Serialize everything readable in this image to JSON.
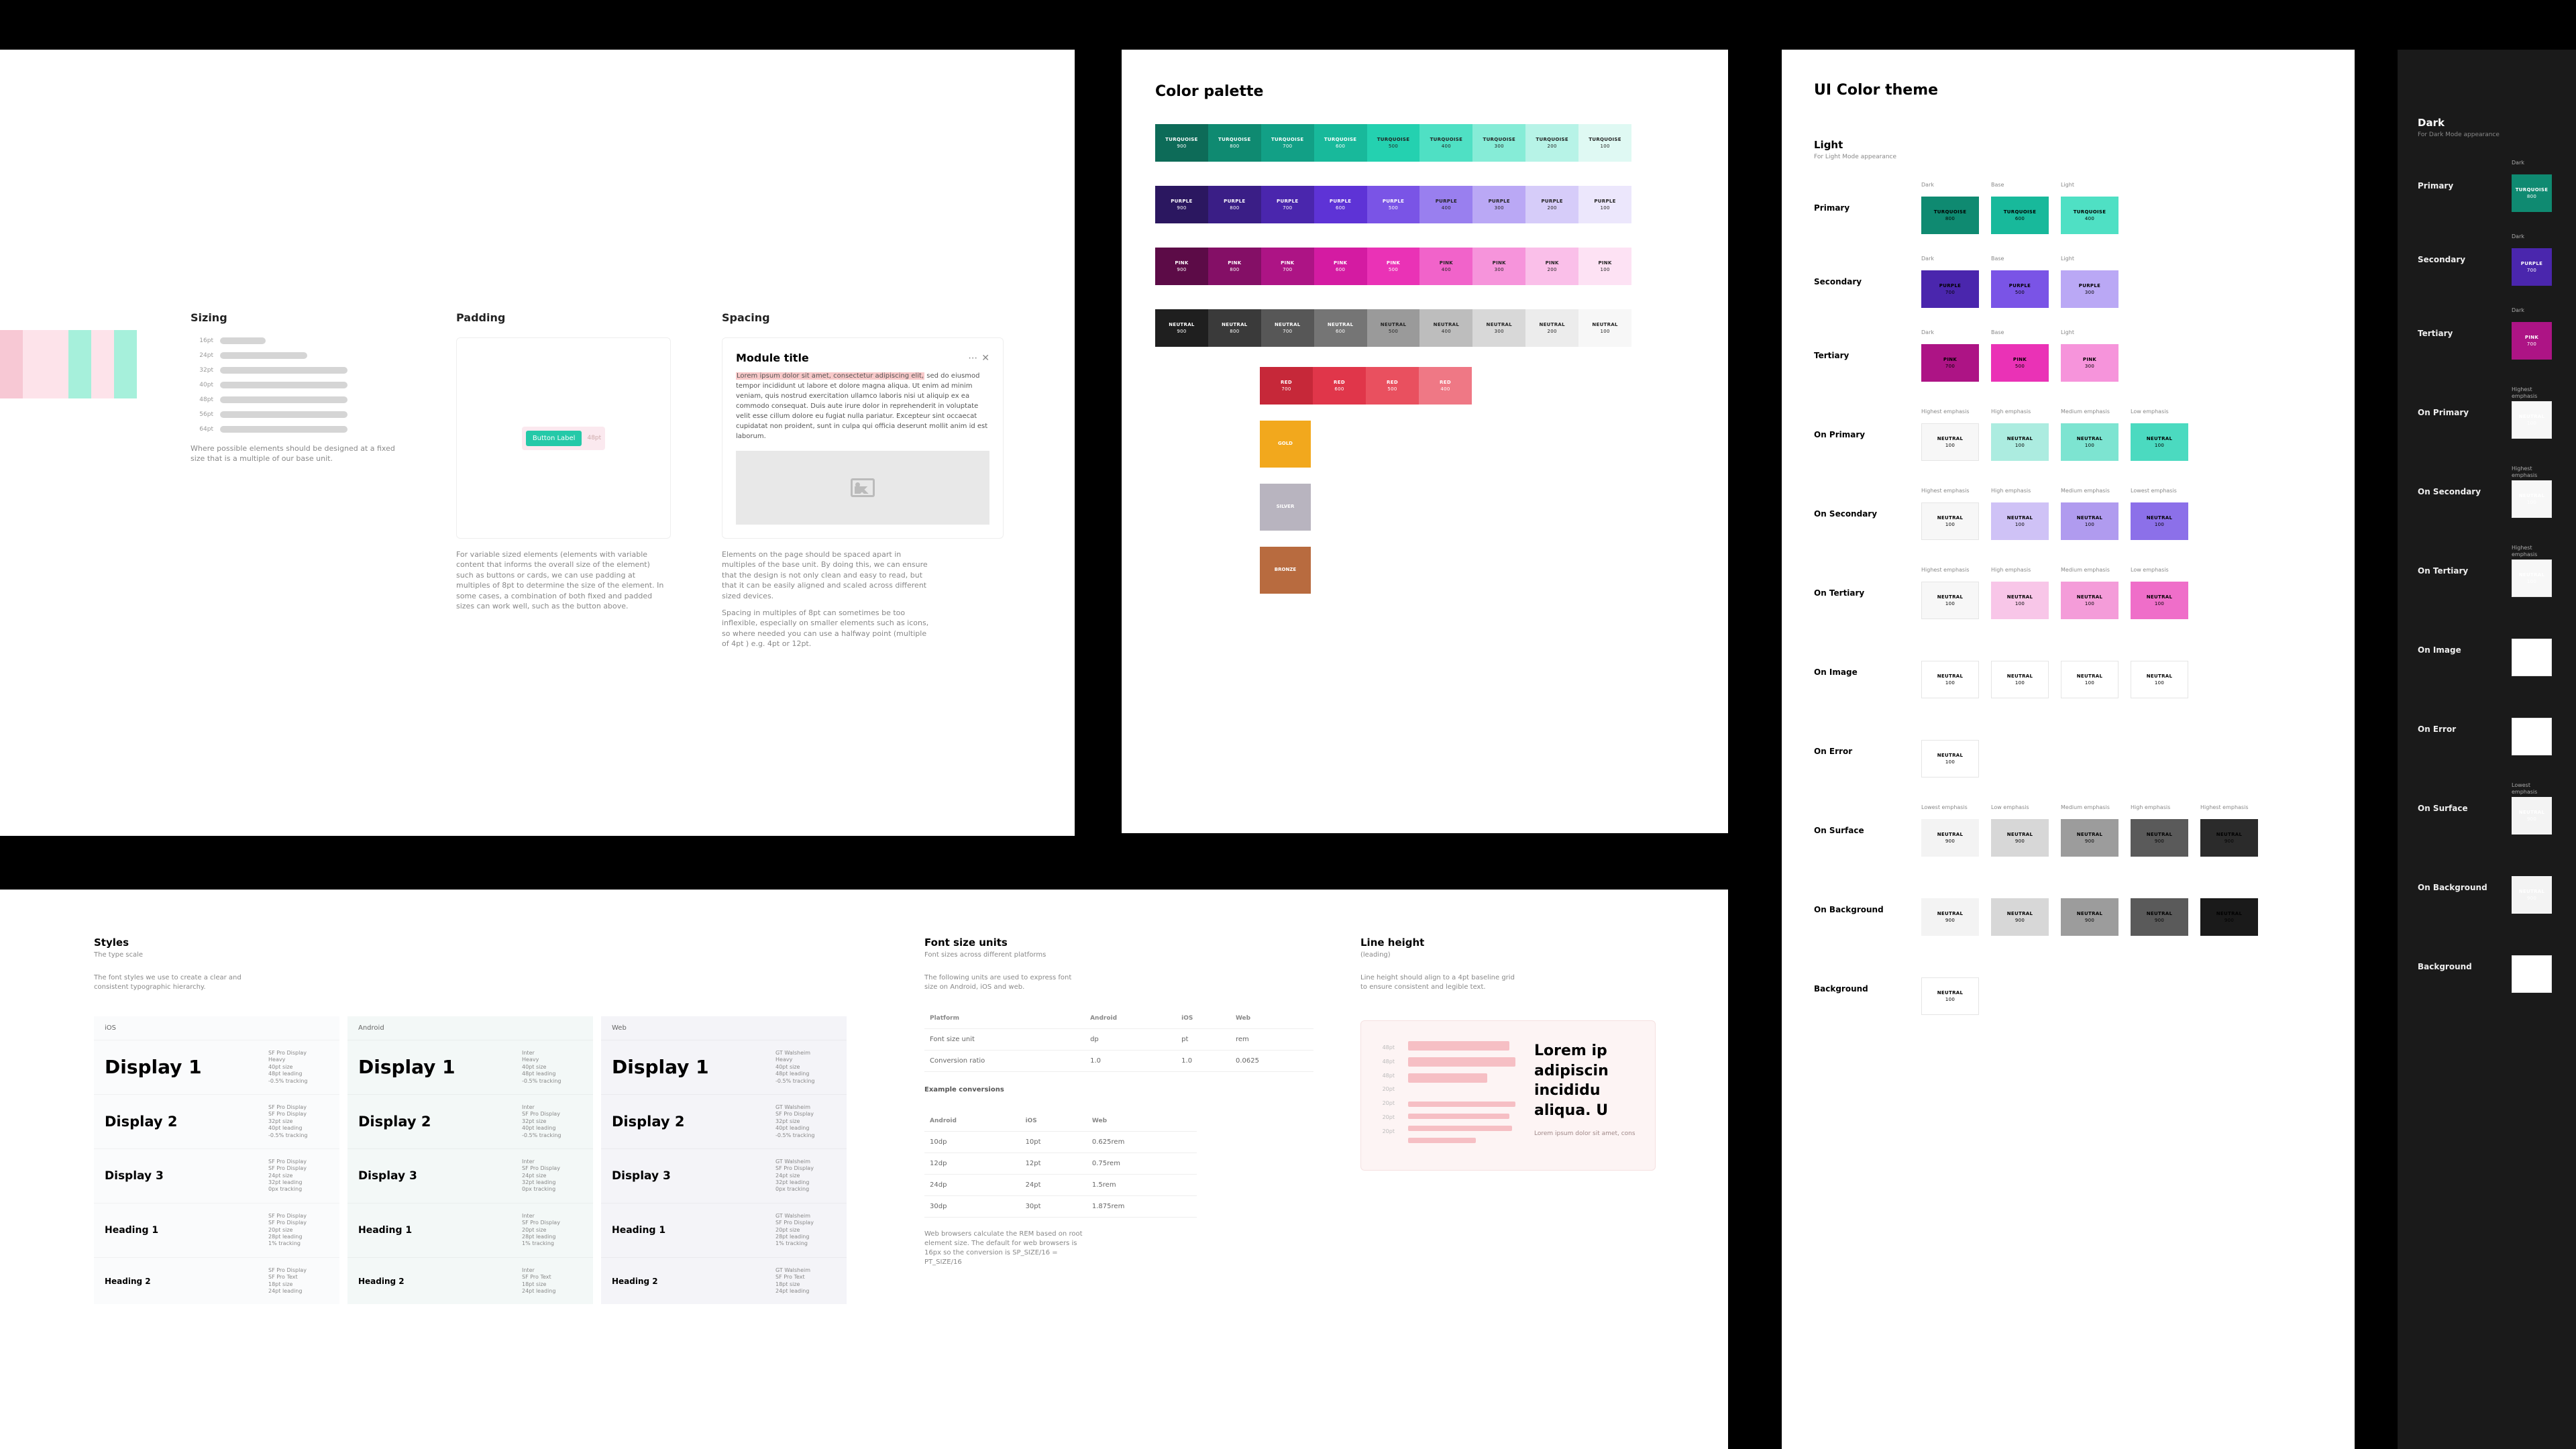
{
  "panelA": {
    "stripes": [
      "#f7c8d4",
      "#fde3ea",
      "#fde3ea",
      "#a6f0db",
      "#fde3ea",
      "#a6f0db"
    ],
    "sizing": {
      "title": "Sizing",
      "bars": [
        {
          "label": "16pt",
          "w": 68
        },
        {
          "label": "24pt",
          "w": 130
        },
        {
          "label": "32pt",
          "w": 190
        },
        {
          "label": "40pt",
          "w": 190
        },
        {
          "label": "48pt",
          "w": 190
        },
        {
          "label": "56pt",
          "w": 190
        },
        {
          "label": "64pt",
          "w": 190
        }
      ],
      "note": "Where possible elements should be designed at a fixed size that is a multiple of our base unit."
    },
    "padding": {
      "title": "Padding",
      "button": "Button Label",
      "hint": "48pt",
      "note": "For variable sized elements (elements with variable content that informs the overall size of the element) such as buttons or cards, we can use padding at multiples of 8pt to determine the size of the element. In some cases, a combination of both fixed and padded sizes can work well, such as the button above."
    },
    "spacing": {
      "title": "Spacing",
      "moduleTitle": "Module title",
      "body": "Lorem ipsum dolor sit amet, consectetur adipiscing elit, sed do eiusmod tempor incididunt ut labore et dolore magna aliqua. Ut enim ad minim veniam, quis nostrud exercitation ullamco laboris nisi ut aliquip ex ea commodo consequat. Duis aute irure dolor in reprehenderit in voluptate velit esse cillum dolore eu fugiat nulla pariatur. Excepteur sint occaecat cupidatat non proident, sunt in culpa qui officia deserunt mollit anim id est laborum.",
      "hi1": "Lorem ipsum dolor sit amet, consectetur adipiscing elit,",
      "hi2": "dolore eu fugiat nulla.",
      "note1": "Elements on the page should be spaced apart in multiples of the base unit. By doing this, we can ensure that the design is not only clean and easy to read, but that it can be easily aligned and scaled across different sized devices.",
      "note2": "Spacing in multiples of 8pt can sometimes be too inflexible, especially on smaller elements such as icons, so where needed you can use a halfway point (multiple of 4pt ) e.g. 4pt or 12pt."
    }
  },
  "panelB": {
    "title": "Color palette",
    "rows": [
      {
        "name": "TURQUOISE",
        "shades": [
          {
            "v": "900",
            "c": "#0d6b58",
            "t": "cw"
          },
          {
            "v": "800",
            "c": "#0f8a71",
            "t": "cw"
          },
          {
            "v": "700",
            "c": "#12a086",
            "t": "cw"
          },
          {
            "v": "600",
            "c": "#18b99b",
            "t": "cw"
          },
          {
            "v": "500",
            "c": "#24d1b0",
            "t": "cd"
          },
          {
            "v": "400",
            "c": "#4fe0c4",
            "t": "cd"
          },
          {
            "v": "300",
            "c": "#86ecd7",
            "t": "cd"
          },
          {
            "v": "200",
            "c": "#b7f3e7",
            "t": "cd"
          },
          {
            "v": "100",
            "c": "#dff9f3",
            "t": "cd"
          }
        ]
      },
      {
        "name": "PURPLE",
        "shades": [
          {
            "v": "900",
            "c": "#2b1760",
            "t": "cw"
          },
          {
            "v": "800",
            "c": "#3a1e86",
            "t": "cw"
          },
          {
            "v": "700",
            "c": "#4a26ad",
            "t": "cw"
          },
          {
            "v": "600",
            "c": "#5e33d6",
            "t": "cw"
          },
          {
            "v": "500",
            "c": "#7a54e6",
            "t": "cw"
          },
          {
            "v": "400",
            "c": "#997fef",
            "t": "cd"
          },
          {
            "v": "300",
            "c": "#baa8f5",
            "t": "cd"
          },
          {
            "v": "200",
            "c": "#d6ccf9",
            "t": "cd"
          },
          {
            "v": "100",
            "c": "#ece7fc",
            "t": "cd"
          }
        ]
      },
      {
        "name": "PINK",
        "shades": [
          {
            "v": "900",
            "c": "#5c0b47",
            "t": "cw"
          },
          {
            "v": "800",
            "c": "#840f66",
            "t": "cw"
          },
          {
            "v": "700",
            "c": "#ad1485",
            "t": "cw"
          },
          {
            "v": "600",
            "c": "#d41ba2",
            "t": "cw"
          },
          {
            "v": "500",
            "c": "#ea32b6",
            "t": "cw"
          },
          {
            "v": "400",
            "c": "#f163ca",
            "t": "cd"
          },
          {
            "v": "300",
            "c": "#f694db",
            "t": "cd"
          },
          {
            "v": "200",
            "c": "#fabfe9",
            "t": "cd"
          },
          {
            "v": "100",
            "c": "#fde2f4",
            "t": "cd"
          }
        ]
      },
      {
        "name": "NEUTRAL",
        "shades": [
          {
            "v": "900",
            "c": "#1f1f1f",
            "t": "cw"
          },
          {
            "v": "800",
            "c": "#3a3a3a",
            "t": "cw"
          },
          {
            "v": "700",
            "c": "#575757",
            "t": "cw"
          },
          {
            "v": "600",
            "c": "#757575",
            "t": "cw"
          },
          {
            "v": "500",
            "c": "#9a9a9a",
            "t": "cd"
          },
          {
            "v": "400",
            "c": "#bdbdbd",
            "t": "cd"
          },
          {
            "v": "300",
            "c": "#d8d8d8",
            "t": "cd"
          },
          {
            "v": "200",
            "c": "#ececec",
            "t": "cd"
          },
          {
            "v": "100",
            "c": "#f7f7f7",
            "t": "cd"
          }
        ]
      }
    ],
    "reds": {
      "name": "RED",
      "shades": [
        {
          "v": "700",
          "c": "#c62839",
          "t": "cw"
        },
        {
          "v": "600",
          "c": "#e0364a",
          "t": "cw"
        },
        {
          "v": "500",
          "c": "#e9505f",
          "t": "cw"
        },
        {
          "v": "400",
          "c": "#ef7885",
          "t": "cw"
        }
      ]
    },
    "solo": [
      {
        "name": "GOLD",
        "v": "",
        "c": "#f2a81d"
      },
      {
        "name": "SILVER",
        "v": "",
        "c": "#b8b4bf"
      },
      {
        "name": "BRONZE",
        "v": "",
        "c": "#b86b3f"
      }
    ]
  },
  "theme": {
    "title": "UI Color theme",
    "light": {
      "title": "Light",
      "sub": "For Light Mode appearance"
    },
    "dark": {
      "title": "Dark",
      "sub": "For Dark Mode appearance"
    },
    "rowsA": [
      {
        "label": "Primary",
        "caps": [
          "Dark",
          "Base",
          "Light"
        ],
        "cells": [
          {
            "n": "TURQUOISE",
            "v": "800",
            "c": "#0f8a71",
            "t": "cw"
          },
          {
            "n": "TURQUOISE",
            "v": "600",
            "c": "#18b99b",
            "t": "cw"
          },
          {
            "n": "TURQUOISE",
            "v": "400",
            "c": "#4fe0c4",
            "t": "cd"
          }
        ]
      },
      {
        "label": "Secondary",
        "caps": [
          "Dark",
          "Base",
          "Light"
        ],
        "cells": [
          {
            "n": "PURPLE",
            "v": "700",
            "c": "#4a26ad",
            "t": "cw"
          },
          {
            "n": "PURPLE",
            "v": "500",
            "c": "#7a54e6",
            "t": "cw"
          },
          {
            "n": "PURPLE",
            "v": "300",
            "c": "#baa8f5",
            "t": "cd"
          }
        ]
      },
      {
        "label": "Tertiary",
        "caps": [
          "Dark",
          "Base",
          "Light"
        ],
        "cells": [
          {
            "n": "PINK",
            "v": "700",
            "c": "#ad1485",
            "t": "cw"
          },
          {
            "n": "PINK",
            "v": "500",
            "c": "#ea32b6",
            "t": "cw"
          },
          {
            "n": "PINK",
            "v": "300",
            "c": "#f694db",
            "t": "cd"
          }
        ]
      }
    ],
    "rowsB": [
      {
        "label": "On Primary",
        "caps": [
          "Highest emphasis",
          "High emphasis",
          "Medium emphasis",
          "Low emphasis"
        ],
        "cells": [
          {
            "n": "NEUTRAL",
            "v": "100",
            "c": "#f7f7f7",
            "t": "cd",
            "bd": 1
          },
          {
            "n": "NEUTRAL",
            "v": "100",
            "c": "#acece0",
            "t": "cd"
          },
          {
            "n": "NEUTRAL",
            "v": "100",
            "c": "#7de4d1",
            "t": "cd"
          },
          {
            "n": "NEUTRAL",
            "v": "100",
            "c": "#4bdac0",
            "t": "cd"
          }
        ]
      },
      {
        "label": "On Secondary",
        "caps": [
          "Highest emphasis",
          "High emphasis",
          "Medium emphasis",
          "Lowest emphasis"
        ],
        "cells": [
          {
            "n": "NEUTRAL",
            "v": "100",
            "c": "#f7f7f7",
            "t": "cd",
            "bd": 1
          },
          {
            "n": "NEUTRAL",
            "v": "100",
            "c": "#cfc2f6",
            "t": "cd"
          },
          {
            "n": "NEUTRAL",
            "v": "100",
            "c": "#b09bef",
            "t": "cd"
          },
          {
            "n": "NEUTRAL",
            "v": "100",
            "c": "#8c70e9",
            "t": "cw"
          }
        ]
      },
      {
        "label": "On Tertiary",
        "caps": [
          "Highest emphasis",
          "High emphasis",
          "Medium emphasis",
          "Low emphasis"
        ],
        "cells": [
          {
            "n": "NEUTRAL",
            "v": "100",
            "c": "#f7f7f7",
            "t": "cd",
            "bd": 1
          },
          {
            "n": "NEUTRAL",
            "v": "100",
            "c": "#f8c6e8",
            "t": "cd"
          },
          {
            "n": "NEUTRAL",
            "v": "100",
            "c": "#f49cd9",
            "t": "cd"
          },
          {
            "n": "NEUTRAL",
            "v": "100",
            "c": "#ef6ec9",
            "t": "cd"
          }
        ]
      },
      {
        "label": "On Image",
        "caps": [
          "",
          "",
          "",
          ""
        ],
        "cells": [
          {
            "n": "NEUTRAL",
            "v": "100",
            "c": "#ffffff",
            "t": "cd",
            "bd": 1
          },
          {
            "n": "NEUTRAL",
            "v": "100",
            "c": "#ffffff",
            "t": "cd",
            "bd": 1
          },
          {
            "n": "NEUTRAL",
            "v": "100",
            "c": "#ffffff",
            "t": "cd",
            "bd": 1
          },
          {
            "n": "NEUTRAL",
            "v": "100",
            "c": "#ffffff",
            "t": "cd",
            "bd": 1
          }
        ]
      },
      {
        "label": "On Error",
        "caps": [
          "",
          "",
          "",
          ""
        ],
        "cells": [
          {
            "n": "NEUTRAL",
            "v": "100",
            "c": "#ffffff",
            "t": "cd",
            "bd": 1
          }
        ]
      },
      {
        "label": "On Surface",
        "caps": [
          "Lowest emphasis",
          "Low emphasis",
          "Medium emphasis",
          "High emphasis",
          "Highest emphasis"
        ],
        "cells": [
          {
            "n": "NEUTRAL",
            "v": "900",
            "c": "#f3f3f3",
            "t": "cd"
          },
          {
            "n": "NEUTRAL",
            "v": "900",
            "c": "#d7d7d7",
            "t": "cd"
          },
          {
            "n": "NEUTRAL",
            "v": "900",
            "c": "#9c9c9c",
            "t": "cw"
          },
          {
            "n": "NEUTRAL",
            "v": "900",
            "c": "#5a5a5a",
            "t": "cw"
          },
          {
            "n": "NEUTRAL",
            "v": "900",
            "c": "#2b2b2b",
            "t": "cw"
          }
        ]
      },
      {
        "label": "On Background",
        "caps": [
          "",
          "",
          "",
          "",
          ""
        ],
        "cells": [
          {
            "n": "NEUTRAL",
            "v": "900",
            "c": "#f3f3f3",
            "t": "cd"
          },
          {
            "n": "NEUTRAL",
            "v": "900",
            "c": "#d7d7d7",
            "t": "cd"
          },
          {
            "n": "NEUTRAL",
            "v": "900",
            "c": "#9c9c9c",
            "t": "cw"
          },
          {
            "n": "NEUTRAL",
            "v": "900",
            "c": "#5a5a5a",
            "t": "cw"
          },
          {
            "n": "NEUTRAL",
            "v": "900",
            "c": "#1a1a1a",
            "t": "cw"
          }
        ]
      },
      {
        "label": "Background",
        "caps": [
          ""
        ],
        "cells": [
          {
            "n": "NEUTRAL",
            "v": "100",
            "c": "#ffffff",
            "t": "cd",
            "bd": 1
          }
        ]
      }
    ]
  },
  "panelE": {
    "styles": {
      "title": "Styles",
      "sub": "The type scale",
      "desc": "The font styles we use to create a clear and consistent typographic hierarchy."
    },
    "platforms": [
      "iOS",
      "Android",
      "Web"
    ],
    "fonts": [
      "SF Pro Display",
      "Inter",
      "GT Walsheim"
    ],
    "tsrows": [
      {
        "name": "Display 1",
        "size": 28,
        "w": "Heavy / Extra Bold / Bold",
        "meta": [
          "Heavy",
          "40pt size",
          "48pt leading",
          "-0.5% tracking"
        ]
      },
      {
        "name": "Display 2",
        "size": 21,
        "w": "Extra Bold",
        "meta": [
          "SF Pro Display",
          "32pt size",
          "40pt leading",
          "-0.5% tracking"
        ]
      },
      {
        "name": "Display 3",
        "size": 17,
        "w": "Bold",
        "meta": [
          "SF Pro Display",
          "24pt size",
          "32pt leading",
          "0px tracking"
        ]
      },
      {
        "name": "Heading 1",
        "size": 14,
        "w": "Bold",
        "meta": [
          "SF Pro Display",
          "20pt size",
          "28pt leading",
          "1% tracking"
        ]
      },
      {
        "name": "Heading 2",
        "size": 12,
        "w": "Semibold",
        "meta": [
          "SF Pro Text",
          "18pt size",
          "24pt leading"
        ]
      }
    ],
    "fs": {
      "title": "Font size units",
      "sub": "Font sizes across different platforms",
      "desc": "The following units are used to express font size on Android, iOS and web.",
      "footer": "Web browsers calculate the REM based on root element size. The default for web browsers is 16px so the conversion is SP_SIZE/16 = PT_SIZE/16",
      "head": [
        "Platform",
        "Android",
        "iOS",
        "Web"
      ],
      "r1": [
        "Font size unit",
        "dp",
        "pt",
        "rem"
      ],
      "r2": [
        "Conversion ratio",
        "1.0",
        "1.0",
        "0.0625"
      ],
      "exTitle": "Example conversions",
      "exHead": [
        "Android",
        "iOS",
        "Web"
      ],
      "ex": [
        [
          "10dp",
          "10pt",
          "0.625rem"
        ],
        [
          "12dp",
          "12pt",
          "0.75rem"
        ],
        [
          "24dp",
          "24pt",
          "1.5rem"
        ],
        [
          "30dp",
          "30pt",
          "1.875rem"
        ]
      ]
    },
    "lh": {
      "title": "Line height",
      "sub": "(leading)",
      "desc": "Line height should align to a 4pt baseline grid to ensure consistent and legible text.",
      "guides": [
        "48pt",
        "48pt",
        "48pt",
        "",
        "20pt",
        "20pt",
        "20pt",
        "20pt"
      ],
      "head": [
        "Lorem ip",
        "adipiscin",
        "incididu",
        "aliqua. U"
      ],
      "para": "Lorem ipsum dolor sit amet, consectetur ut labore et dolore magna aliqua ex ea commodo dolore eu fugiat nulla."
    }
  }
}
